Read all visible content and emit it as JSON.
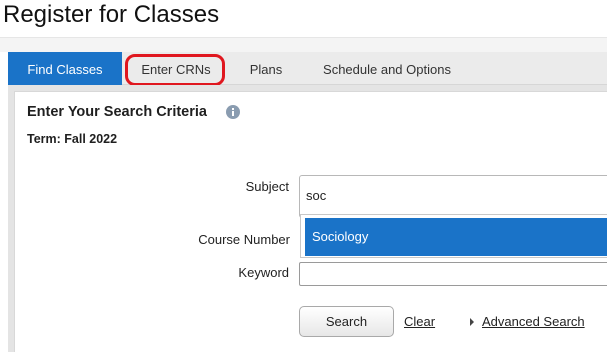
{
  "header": {
    "title": "Register for Classes"
  },
  "tabs": [
    {
      "label": "Find Classes",
      "active": true
    },
    {
      "label": "Enter CRNs",
      "active": false,
      "highlighted": true
    },
    {
      "label": "Plans",
      "active": false
    },
    {
      "label": "Schedule and Options",
      "active": false
    }
  ],
  "criteria": {
    "title": "Enter Your Search Criteria",
    "info_icon": "info-icon",
    "term": "Term: Fall 2022"
  },
  "form": {
    "subject_label": "Subject",
    "subject_value": "soc",
    "subject_suggestion": "Sociology",
    "course_number_label": "Course Number",
    "keyword_label": "Keyword",
    "keyword_value": ""
  },
  "actions": {
    "search": "Search",
    "clear": "Clear",
    "advanced": "Advanced Search"
  },
  "colors": {
    "accent": "#1a73c8",
    "highlight_ring": "#e0171f"
  }
}
